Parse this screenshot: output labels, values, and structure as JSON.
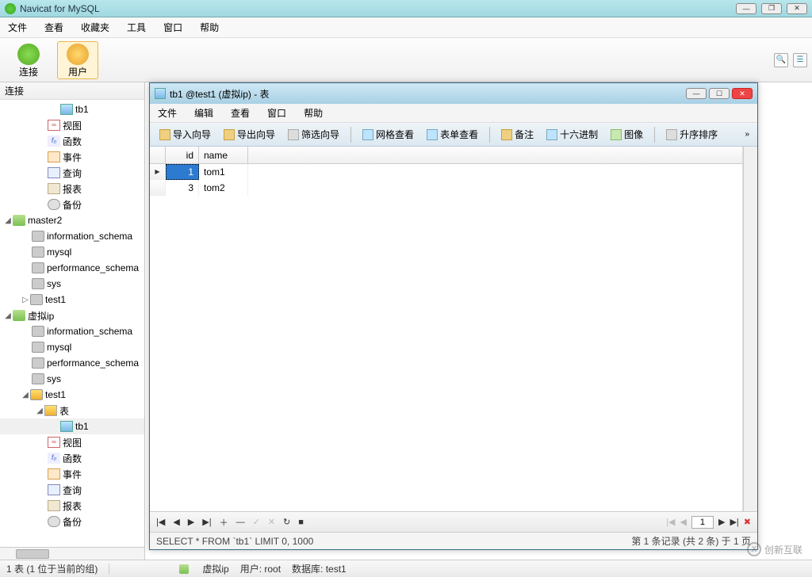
{
  "app": {
    "title": "Navicat for MySQL"
  },
  "menus": [
    "文件",
    "查看",
    "收藏夹",
    "工具",
    "窗口",
    "帮助"
  ],
  "toolbar": {
    "connect": "连接",
    "user": "用户"
  },
  "sidebar": {
    "header": "连接",
    "first_items": [
      {
        "icon": "ic-table",
        "label": "tb1",
        "indent": 76
      },
      {
        "icon": "ic-view",
        "glyph": "👓",
        "label": "视图",
        "indent": 60
      },
      {
        "icon": "ic-fn",
        "glyph": "f₀",
        "label": "函数",
        "indent": 60
      },
      {
        "icon": "ic-event",
        "label": "事件",
        "indent": 60
      },
      {
        "icon": "ic-query",
        "label": "查询",
        "indent": 60
      },
      {
        "icon": "ic-report",
        "label": "报表",
        "indent": 60
      },
      {
        "icon": "ic-backup",
        "label": "备份",
        "indent": 60
      }
    ],
    "server2": {
      "label": "master2",
      "children": [
        {
          "icon": "ic-db",
          "label": "information_schema"
        },
        {
          "icon": "ic-db",
          "label": "mysql"
        },
        {
          "icon": "ic-db",
          "label": "performance_schema"
        },
        {
          "icon": "ic-db",
          "label": "sys"
        },
        {
          "icon": "ic-db",
          "label": "test1",
          "arrow": "▷"
        }
      ]
    },
    "server3": {
      "label": "虚拟ip",
      "children": [
        {
          "icon": "ic-db",
          "label": "information_schema"
        },
        {
          "icon": "ic-db",
          "label": "mysql"
        },
        {
          "icon": "ic-db",
          "label": "performance_schema"
        },
        {
          "icon": "ic-db",
          "label": "sys"
        }
      ],
      "test1": {
        "label": "test1",
        "tables_label": "表",
        "table": "tb1",
        "subitems": [
          {
            "icon": "ic-view",
            "label": "视图"
          },
          {
            "icon": "ic-fn",
            "label": "函数"
          },
          {
            "icon": "ic-event",
            "label": "事件"
          },
          {
            "icon": "ic-query",
            "label": "查询"
          },
          {
            "icon": "ic-report",
            "label": "报表"
          },
          {
            "icon": "ic-backup",
            "label": "备份"
          }
        ]
      }
    }
  },
  "inner": {
    "title": "tb1 @test1 (虚拟ip) - 表",
    "menus": [
      "文件",
      "编辑",
      "查看",
      "窗口",
      "帮助"
    ],
    "toolbar": {
      "import": "导入向导",
      "export": "导出向导",
      "filter": "筛选向导",
      "gridview": "网格查看",
      "formview": "表单查看",
      "note": "备注",
      "hex": "十六进制",
      "image": "图像",
      "sortasc": "升序排序"
    },
    "grid": {
      "cols": {
        "id": "id",
        "name": "name"
      },
      "rows": [
        {
          "id": "1",
          "name": "tom1",
          "sel": true
        },
        {
          "id": "3",
          "name": "tom2",
          "sel": false
        }
      ]
    },
    "nav": {
      "page": "1"
    },
    "sql": "SELECT * FROM `tb1` LIMIT 0, 1000",
    "record_info": "第 1 条记录 (共 2 条) 于 1 页"
  },
  "status": {
    "left": "1 表 (1 位于当前的组)",
    "conn": "虚拟ip",
    "user_label": "用户: ",
    "user": "root",
    "db_label": "数据库: ",
    "db": "test1"
  },
  "watermark": "创新互联"
}
